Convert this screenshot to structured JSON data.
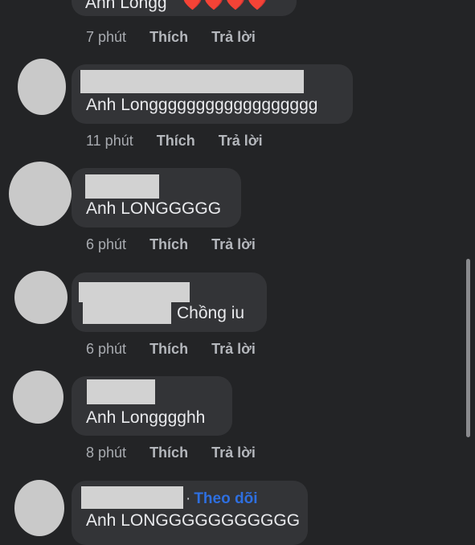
{
  "comments": [
    {
      "text": "Anh Longg",
      "hearts": "❤️❤️❤️❤️",
      "time": "7 phút",
      "like": "Thích",
      "reply": "Trả lời"
    },
    {
      "text": "Anh Longggggggggggggggggg",
      "time": "11 phút",
      "like": "Thích",
      "reply": "Trả lời"
    },
    {
      "text": "Anh LONGGGGG",
      "time": "6 phút",
      "like": "Thích",
      "reply": "Trả lời"
    },
    {
      "text": "Chồng iu",
      "time": "6 phút",
      "like": "Thích",
      "reply": "Trả lời"
    },
    {
      "text": "Anh Longggghh",
      "time": "8 phút",
      "like": "Thích",
      "reply": "Trả lời"
    },
    {
      "text": "Anh LONGGGGGGGGGGG",
      "follow": "Theo dõi"
    }
  ],
  "colors": {
    "background": "#232426",
    "bubble": "#333437",
    "follow": "#2e6fe0"
  },
  "icons": {
    "heart": "heart-icon"
  }
}
